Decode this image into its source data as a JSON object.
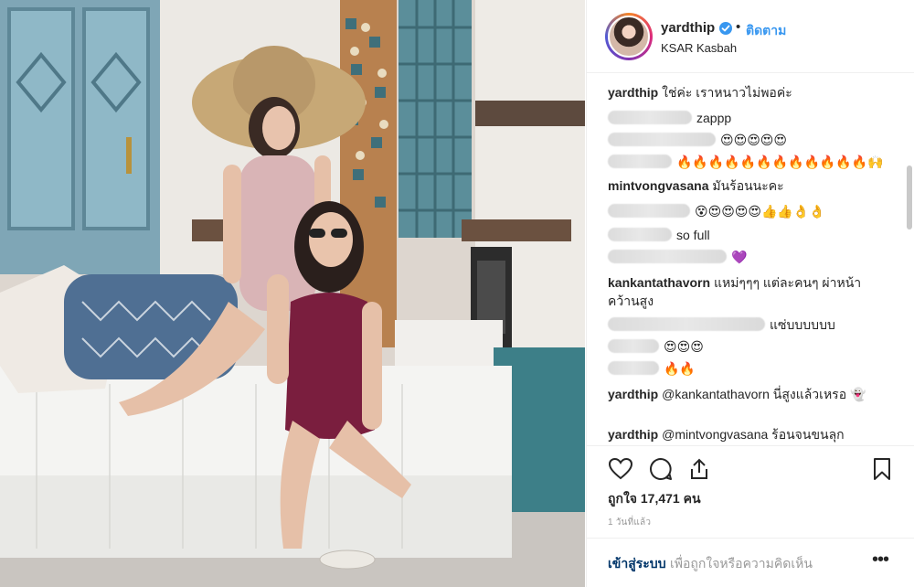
{
  "post": {
    "username": "yardthip",
    "follow_label": "ติดตาม",
    "dot": "•",
    "location": "KSAR Kasbah",
    "verified_icon": "verified-badge-icon"
  },
  "comments": [
    {
      "user": "yardthip",
      "text": "ใช่ค่ะ เราหนาวไม่พอค่ะ",
      "blurred": false
    },
    {
      "user": "",
      "text": "zappp",
      "blurred": true,
      "blur_w": 92
    },
    {
      "user": "",
      "text": "😍😍😍😍😍",
      "blurred": true,
      "blur_w": 118
    },
    {
      "user": "",
      "text": "🔥🔥🔥🔥🔥🔥🔥🔥🔥🔥🔥🔥🙌",
      "blurred": true,
      "blur_w": 70
    },
    {
      "user": "mintvongvasana",
      "text": "มันร้อนนะคะ",
      "blurred": false
    },
    {
      "user": "",
      "text": "😵😍😍😍😍👍👍👌👌",
      "blurred": true,
      "blur_w": 90
    },
    {
      "user": "",
      "text": "so full",
      "blurred": true,
      "blur_w": 70
    },
    {
      "user": "",
      "text": "💜",
      "blurred": true,
      "blur_w": 130
    },
    {
      "user": "kankantathavorn",
      "text": "แหม่ๆๆๆ แต่ละคนๆ ผ่าหน้า คว้านสูง",
      "blurred": false
    },
    {
      "user": "",
      "text": "แซ่บบบบบบ",
      "blurred": true,
      "blur_w": 172
    },
    {
      "user": "",
      "text": "😍😍😍",
      "blurred": true,
      "blur_w": 56
    },
    {
      "user": "",
      "text": "🔥🔥",
      "blurred": true,
      "blur_w": 56
    },
    {
      "user": "yardthip",
      "text": "@kankantathavorn นี่สูงแล้วเหรอ 👻",
      "blurred": false
    },
    {
      "user": "yardthip",
      "text": "@mintvongvasana ร้อนจนขนลุก",
      "blurred": false
    }
  ],
  "actions": {
    "like_icon": "heart-icon",
    "comment_icon": "comment-icon",
    "share_icon": "share-icon",
    "save_icon": "bookmark-icon"
  },
  "likes_text": "ถูกใจ 17,471 คน",
  "age_text": "1 วันที่แล้ว",
  "add_comment": {
    "login_label": "เข้าสู่ระบบ",
    "rest_text": "เพื่อถูกใจหรือความคิดเห็น",
    "more_label": "•••"
  },
  "colors": {
    "accent": "#3897f0",
    "text": "#262626",
    "muted": "#999999"
  }
}
